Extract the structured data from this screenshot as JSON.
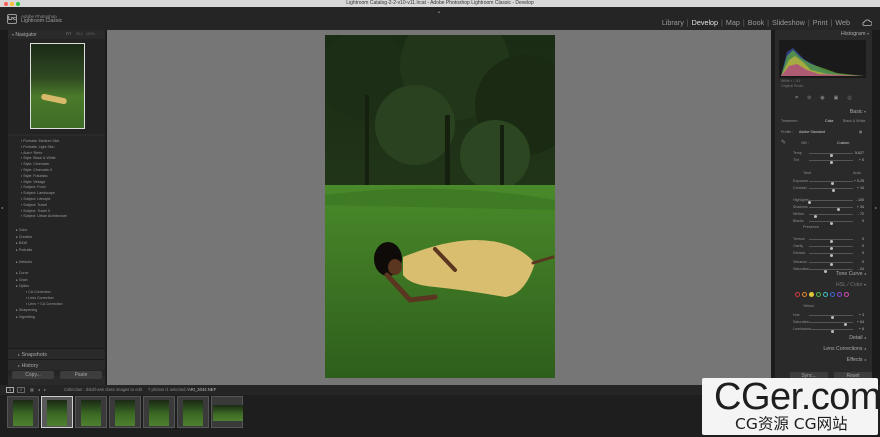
{
  "window": {
    "title": "Lightroom Catalog-2-2-v10-v11.lrcat - Adobe Photoshop Lightroom Classic - Develop"
  },
  "app": {
    "vendor": "Adobe Photoshop",
    "name": "Lightroom Classic",
    "logo": "Lrc"
  },
  "modules": [
    "Library",
    "Develop",
    "Map",
    "Book",
    "Slideshow",
    "Print",
    "Web"
  ],
  "active_module": "Develop",
  "left_panel": {
    "navigator": {
      "title": "Navigator",
      "zoom": [
        "FIT",
        "FILL",
        "100%",
        "100%"
      ]
    },
    "presets": [
      "Portraits: Medium Skin",
      "Portraits: Light Skin",
      "Auto+ Retro",
      "Style: Black & White",
      "Style: Cinematic",
      "Style: Cinematic II",
      "Style: Futuristic",
      "Style: Vintage",
      "Subject: Food",
      "Subject: Landscape",
      "Subject: Lifestyle",
      "Subject: Travel",
      "Subject: Travel II",
      "Subject: Urban Architecture"
    ],
    "groups_a": [
      "Color",
      "Creative",
      "B&W",
      "Portraits"
    ],
    "groups_b": [
      "Defaults"
    ],
    "groups_c": [
      "Curve",
      "Grain",
      "Optics"
    ],
    "optics_sub": [
      "CA Correction",
      "Lens Correction",
      "Lens + CA Correction"
    ],
    "groups_d": [
      "Sharpening",
      "Vignetting"
    ],
    "snapshots": "Snapshots",
    "history": "History",
    "copy": "Copy...",
    "paste": "Paste"
  },
  "right_panel": {
    "histogram": "Histogram",
    "histo_info": "White ▪ □ 41",
    "original_photo": "Original Photo",
    "basic": "Basic",
    "treatment": "Treatment :",
    "color": "Color",
    "bw": "Black & White",
    "profile": "Profile :",
    "profile_value": "Adobe Standard",
    "wb": "WB :",
    "wb_value": "Custom",
    "tone": "Tone",
    "auto": "Auto",
    "presence": "Presence",
    "sliders": [
      {
        "label": "Temp",
        "value": "5,627",
        "pos": 0.5
      },
      {
        "label": "Tint",
        "value": "+ 5",
        "pos": 0.52
      },
      {
        "label": "Exposure",
        "value": "+ 0.25",
        "pos": 0.53
      },
      {
        "label": "Contrast",
        "value": "+ 10",
        "pos": 0.55
      },
      {
        "label": "Highlights",
        "value": "- 100",
        "pos": 0.0
      },
      {
        "label": "Shadows",
        "value": "+ 34",
        "pos": 0.67
      },
      {
        "label": "Whites",
        "value": "- 72",
        "pos": 0.14
      },
      {
        "label": "Blacks",
        "value": "0",
        "pos": 0.5
      },
      {
        "label": "Texture",
        "value": "0",
        "pos": 0.5
      },
      {
        "label": "Clarity",
        "value": "0",
        "pos": 0.5
      },
      {
        "label": "Dehaze",
        "value": "0",
        "pos": 0.5
      },
      {
        "label": "Vibrance",
        "value": "0",
        "pos": 0.5
      },
      {
        "label": "Saturation",
        "value": "- 24",
        "pos": 0.38
      }
    ],
    "tone_curve": "Tone Curve",
    "hsl": "HSL / Color",
    "yellow": "Yellow",
    "hsl_sliders": [
      {
        "label": "Hue",
        "value": "+ 3",
        "pos": 0.53
      },
      {
        "label": "Saturation",
        "value": "+ 64",
        "pos": 0.82
      },
      {
        "label": "Luminance",
        "value": "+ 8",
        "pos": 0.54
      }
    ],
    "detail": "Detail",
    "lens": "Lens Corrections",
    "effects": "Effects",
    "sync": "Sync...",
    "reset": "Reset"
  },
  "filmstrip": {
    "info": "Collection : dsldrl-ase class images to edit",
    "count": "7 photos /1 selected /",
    "file": "ARI_3044.NEF",
    "pages": [
      "1",
      "2"
    ]
  },
  "watermark": {
    "main": "CGer.com",
    "sub": "CG资源 CG网站"
  },
  "colors": {
    "accent": "#e4e4e4",
    "panel": "#2a2a2a",
    "bg": "#767676"
  }
}
